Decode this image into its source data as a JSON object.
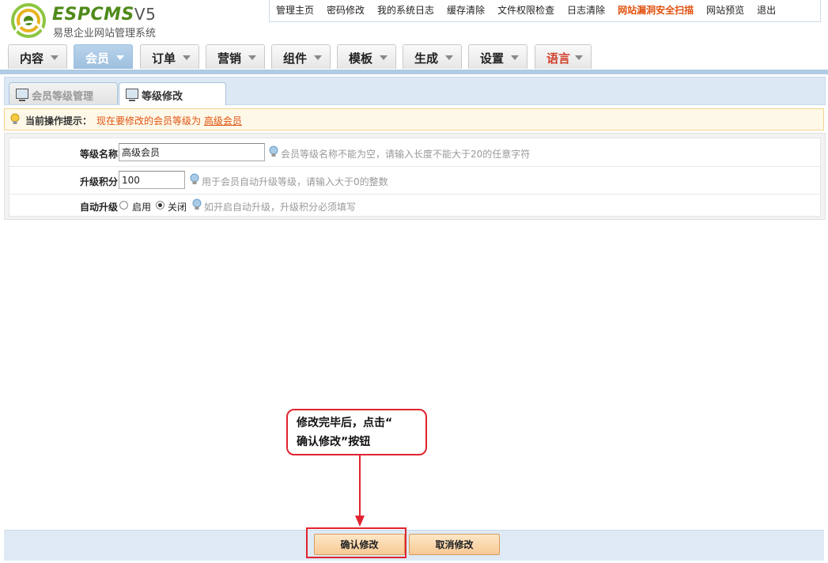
{
  "header": {
    "logo_main": "ESPCMS",
    "logo_version": "V5",
    "logo_sub": "易思企业网站管理系统",
    "top_links": [
      {
        "label": "管理主页",
        "highlight": false
      },
      {
        "label": "密码修改",
        "highlight": false
      },
      {
        "label": "我的系统日志",
        "highlight": false
      },
      {
        "label": "缓存清除",
        "highlight": false
      },
      {
        "label": "文件权限检查",
        "highlight": false
      },
      {
        "label": "日志清除",
        "highlight": false
      },
      {
        "label": "网站漏洞安全扫描",
        "highlight": true
      },
      {
        "label": "网站预览",
        "highlight": false
      },
      {
        "label": "退出",
        "highlight": false
      }
    ]
  },
  "nav": {
    "tabs": [
      {
        "label": "内容",
        "active": false
      },
      {
        "label": "会员",
        "active": true
      },
      {
        "label": "订单",
        "active": false
      },
      {
        "label": "营销",
        "active": false
      },
      {
        "label": "组件",
        "active": false
      },
      {
        "label": "模板",
        "active": false
      },
      {
        "label": "生成",
        "active": false
      },
      {
        "label": "设置",
        "active": false
      },
      {
        "label": "语言",
        "active": false,
        "red": true
      }
    ]
  },
  "subtabs": [
    {
      "label": "会员等级管理",
      "active": false
    },
    {
      "label": "等级修改",
      "active": true
    }
  ],
  "tip": {
    "label": "当前操作提示：",
    "message": "现在要修改的会员等级为",
    "link": "高级会员"
  },
  "form": {
    "name_label": "等级名称",
    "name_value": "高级会员",
    "name_hint": "会员等级名称不能为空，请输入长度不能大于20的任意字符",
    "points_label": "升级积分",
    "points_value": "100",
    "points_hint": "用于会员自动升级等级，请输入大于0的整数",
    "auto_label": "自动升级",
    "auto_on_label": "启用",
    "auto_off_label": "关闭",
    "auto_selected": "关闭",
    "auto_hint": "如开启自动升级，升级积分必须填写"
  },
  "annotation": {
    "line1": "修改完毕后，点击“",
    "line2": "确认修改”按钮"
  },
  "buttons": {
    "confirm": "确认修改",
    "cancel": "取消修改"
  },
  "colors": {
    "accent_blue": "#9dbfdf",
    "highlight_orange": "#e0520f",
    "annotation_red": "#e0242f"
  }
}
